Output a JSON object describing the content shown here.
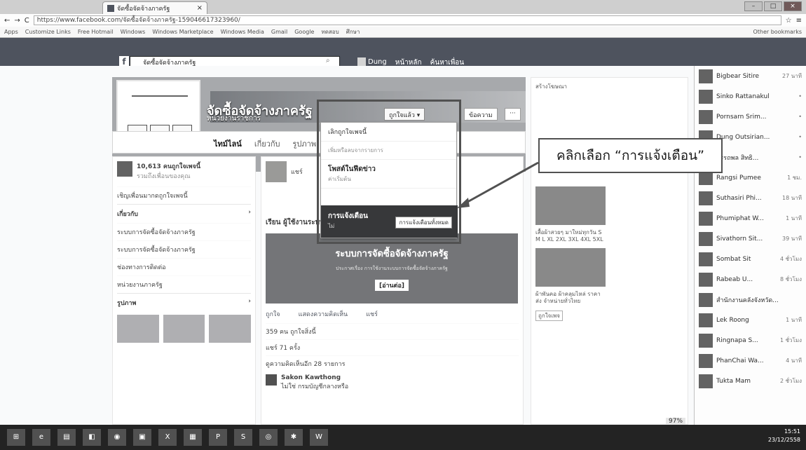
{
  "browser": {
    "tab_title": "จัดซื้อจัดจ้างภาครัฐ",
    "url": "https://www.facebook.com/จัดซื้อจัดจ้างภาครัฐ-159046617323960/",
    "bookmarks": [
      "Apps",
      "Customize Links",
      "Free Hotmail",
      "Windows",
      "Windows Marketplace",
      "Windows Media",
      "Gmail",
      "Google",
      "ทดสอบ",
      "ศึกษา",
      "Other bookmarks"
    ]
  },
  "fb": {
    "search_value": "จัดซื้อจัดจ้างภาครัฐ",
    "nav": [
      "Dung",
      "หน้าหลัก",
      "ค้นหาเพื่อน"
    ]
  },
  "page": {
    "title": "จัดซื้อจัดจ้างภาครัฐ",
    "category": "หน่วยงานราชการ",
    "follow_btn": "ถูกใจแล้ว ▾",
    "message_btn": "ข้อความ",
    "more_btn": "···",
    "tabs": [
      "ไทม์ไลน์",
      "เกี่ยวกับ",
      "รูปภาพ"
    ]
  },
  "dropdown": {
    "item1": "เลิกถูกใจเพจนี้",
    "item2": "เพิ่มหรือลบจากรายการ",
    "item3_title": "โพสต์ในฟีดข่าว",
    "item3_sub": "ค่าเริ่มต้น",
    "notif_title": "การแจ้งเตือน",
    "notif_sub": "ไม่",
    "notif_button": "การแจ้งเตือนทั้งหมด"
  },
  "annotation": {
    "callout": "คลิกเลือก “การแจ้งเตือน”"
  },
  "left": {
    "likes": "10,613 คนถูกใจเพจนี้",
    "likes_sub": "รวมถึงเพื่อนของคุณ",
    "invite": "เชิญเพื่อนมากดถูกใจเพจนี้",
    "about_hdr": "เกี่ยวกับ",
    "about_rows": [
      "ระบบการจัดซื้อจัดจ้างภาครัฐ",
      "ระบบการจัดซื้อจัดจ้างภาครัฐ",
      "ช่องทางการติดต่อ",
      "หน่วยงานภาครัฐ"
    ],
    "photos_hdr": "รูปภาพ"
  },
  "center": {
    "status_prefix": "แชร์",
    "post_author": "เรียน ผู้ใช้งานระบบ e-GP",
    "banner_title": "ระบบการจัดซื้อจัดจ้างภาครัฐ",
    "banner_small": "ประกาศเรื่อง การใช้งานระบบการจัดซื้อจัดจ้างภาครัฐ",
    "banner_more": "[อ่านต่อ]",
    "actions": [
      "ถูกใจ",
      "แสดงความคิดเห็น",
      "แชร์"
    ],
    "likes_line": "359 คน ถูกใจสิ่งนี้",
    "shares_line": "แชร์ 71 ครั้ง",
    "comments_line": "ดูความคิดเห็นอีก 28 รายการ",
    "comment_author": "Sakon Kawthong",
    "comment_text": "ไม่ใช่ กรมบัญชีกลางหรือ"
  },
  "right": {
    "create": "สร้างโฆษณา",
    "ad1": "เสื้อผ้าสวยๆ มาใหม่ทุกวัน S M L XL 2XL 3XL 4XL 5XL",
    "ad2": "ผ้าพันคอ ผ้าคลุมไหล่ ราคาส่ง จำหน่ายทั่วไทย",
    "badge": "ถูกใจเพจ"
  },
  "chat": [
    {
      "name": "Bigbear Sitire",
      "status": "27 นาที"
    },
    {
      "name": "Sinko Rattanakul",
      "status": "•"
    },
    {
      "name": "Pornsarn Srim...",
      "status": "•"
    },
    {
      "name": "Dung Outsirian...",
      "status": "•"
    },
    {
      "name": "อรรถพล สิทธิ...",
      "status": "•"
    },
    {
      "name": "Rangsi Pumee",
      "status": "1 ชม."
    },
    {
      "name": "Suthasiri Phi...",
      "status": "18 นาที"
    },
    {
      "name": "Phumiphat W...",
      "status": "1 นาที"
    },
    {
      "name": "Sivathorn Sit...",
      "status": "39 นาที"
    },
    {
      "name": "Sombat Sit",
      "status": "4 ชั่วโมง"
    },
    {
      "name": "Rabeab U...",
      "status": "8 ชั่วโมง"
    },
    {
      "name": "สำนักงานคลังจังหวัด...",
      "status": ""
    },
    {
      "name": "Lek Roong",
      "status": "1 นาที"
    },
    {
      "name": "Ringnapa S...",
      "status": "1 ชั่วโมง"
    },
    {
      "name": "PhanChai Wa...",
      "status": "4 นาที"
    },
    {
      "name": "Tukta Mam",
      "status": "2 ชั่วโมง"
    }
  ],
  "status": {
    "zoom": "97%",
    "time": "15:51",
    "date": "23/12/2558"
  }
}
